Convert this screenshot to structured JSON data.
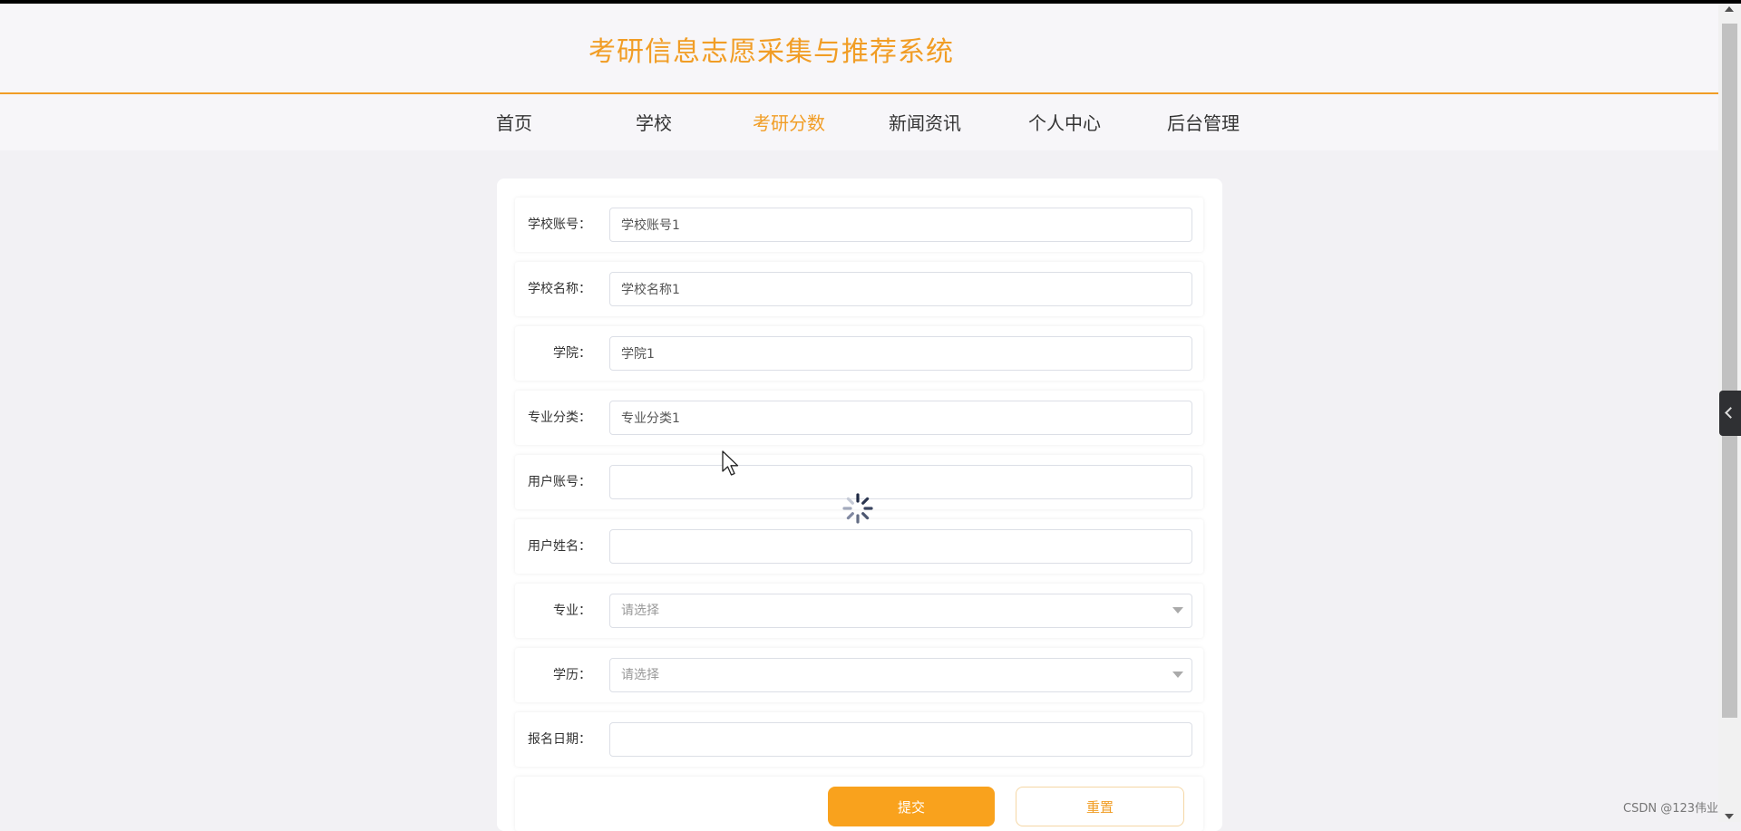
{
  "header": {
    "title": "考研信息志愿采集与推荐系统"
  },
  "nav": {
    "items": [
      {
        "label": "首页"
      },
      {
        "label": "学校"
      },
      {
        "label": "考研分数"
      },
      {
        "label": "新闻资讯"
      },
      {
        "label": "个人中心"
      },
      {
        "label": "后台管理"
      }
    ],
    "active": "考研分数"
  },
  "form": {
    "fields": [
      {
        "label": "学校账号：",
        "value": "学校账号1",
        "placeholder": ""
      },
      {
        "label": "学校名称：",
        "value": "学校名称1",
        "placeholder": ""
      },
      {
        "label": "学院：",
        "value": "学院1",
        "placeholder": ""
      },
      {
        "label": "专业分类：",
        "value": "专业分类1",
        "placeholder": ""
      },
      {
        "label": "用户账号：",
        "value": "",
        "placeholder": ""
      },
      {
        "label": "用户姓名：",
        "value": "",
        "placeholder": ""
      },
      {
        "label": "专业：",
        "value": "",
        "placeholder": "请选择"
      },
      {
        "label": "学历：",
        "value": "",
        "placeholder": "请选择"
      },
      {
        "label": "报名日期：",
        "value": "",
        "placeholder": ""
      }
    ],
    "submit_label": "提交",
    "reset_label": "重置"
  },
  "watermark": "CSDN @123伟业",
  "colors": {
    "accent": "#f19d25",
    "button": "#f9a21d"
  },
  "icons": {
    "loading": "loading-spinner-icon",
    "cursor": "mouse-pointer-icon",
    "side_toggle": "chevron-left-icon"
  }
}
